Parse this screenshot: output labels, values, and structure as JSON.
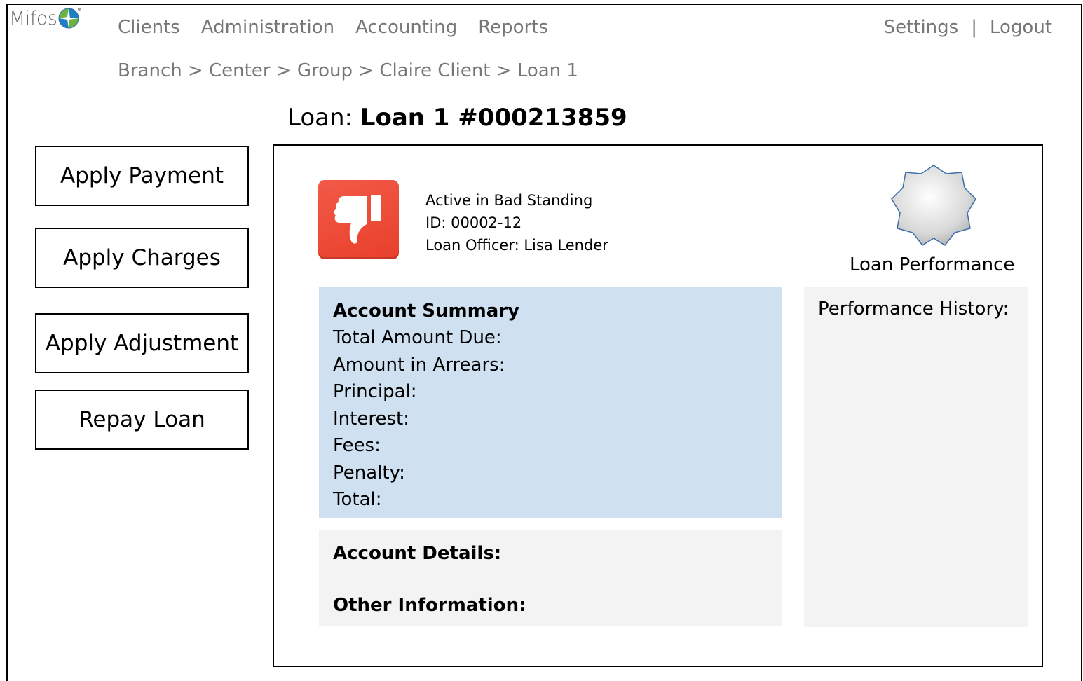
{
  "app": {
    "logo_text": "Mifos"
  },
  "nav": {
    "items": [
      "Clients",
      "Administration",
      "Accounting",
      "Reports"
    ]
  },
  "toplinks": {
    "settings": "Settings",
    "separator": "|",
    "logout": "Logout"
  },
  "breadcrumb": "Branch > Center > Group  > Claire Client > Loan 1",
  "page": {
    "title_prefix": "Loan: ",
    "title_name": "Loan 1 #000213859"
  },
  "actions": [
    "Apply Payment",
    "Apply Charges",
    "Apply Adjustment",
    "Repay Loan"
  ],
  "status": {
    "state": "Active in Bad Standing",
    "id": "ID: 00002-12",
    "officer": "Loan Officer: Lisa Lender",
    "icon": "thumbs-down-icon",
    "color": "#ea4630"
  },
  "performance": {
    "label": "Loan Performance",
    "history_label": "Performance History:"
  },
  "summary": {
    "heading": "Account Summary",
    "rows": [
      "Total Amount Due:",
      "Amount in Arrears:",
      "Principal:",
      "Interest:",
      "Fees:",
      "Penalty:",
      "Total:"
    ]
  },
  "details": {
    "account_details": "Account Details:",
    "other_information": "Other Information:"
  },
  "colors": {
    "summary_bg": "#cfe0f1",
    "panel_bg": "#f3f3f3",
    "nav_text": "#777777"
  }
}
